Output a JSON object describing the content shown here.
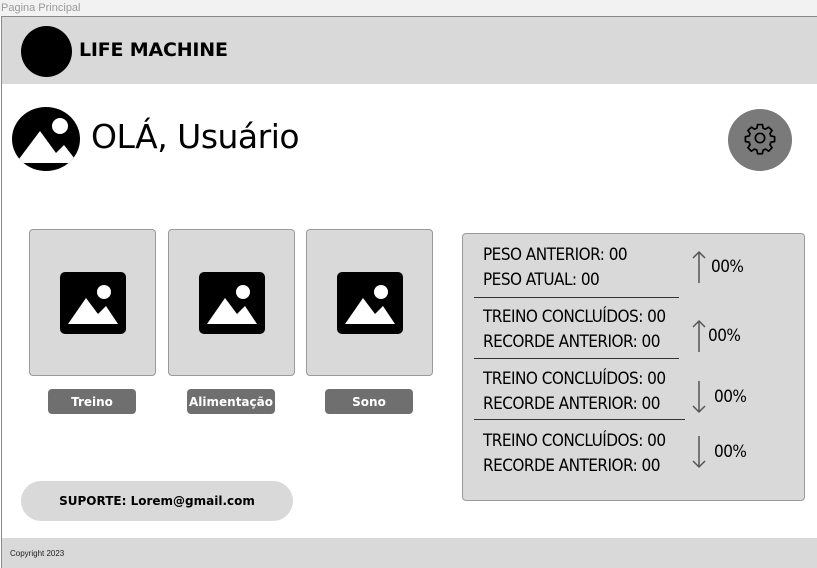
{
  "frame_label": "Pagina Principal",
  "header": {
    "app_name": "LIFE MACHINE"
  },
  "greeting": "OLÁ, Usuário",
  "icons": {
    "logo": "circle-logo",
    "avatar": "user-avatar-icon",
    "settings": "gear-icon",
    "card_image": "image-placeholder-icon",
    "arrow_up": "arrow-up-icon",
    "arrow_down": "arrow-down-icon"
  },
  "cards": [
    {
      "label": "Treino"
    },
    {
      "label": "Alimentação"
    },
    {
      "label": "Sono"
    }
  ],
  "support": {
    "text": "SUPORTE: Lorem@gmail.com"
  },
  "stats": [
    {
      "line1": "PESO ANTERIOR: 00",
      "line2": "PESO ATUAL: 00",
      "trend": "up",
      "percent": "00%"
    },
    {
      "line1": "TREINO CONCLUÍDOS: 00",
      "line2": "RECORDE ANTERIOR: 00",
      "trend": "up",
      "percent": "00%"
    },
    {
      "line1": "TREINO CONCLUÍDOS: 00",
      "line2": "RECORDE ANTERIOR: 00",
      "trend": "down",
      "percent": "00%"
    },
    {
      "line1": "TREINO CONCLUÍDOS: 00",
      "line2": "RECORDE ANTERIOR: 00",
      "trend": "down",
      "percent": "00%"
    }
  ],
  "footer": {
    "copyright": "Copyright 2023"
  },
  "colors": {
    "bar_gray": "#d9d9d9",
    "button_gray": "#6f6f70",
    "settings_gray": "#7a7a7a",
    "text": "#000000"
  }
}
